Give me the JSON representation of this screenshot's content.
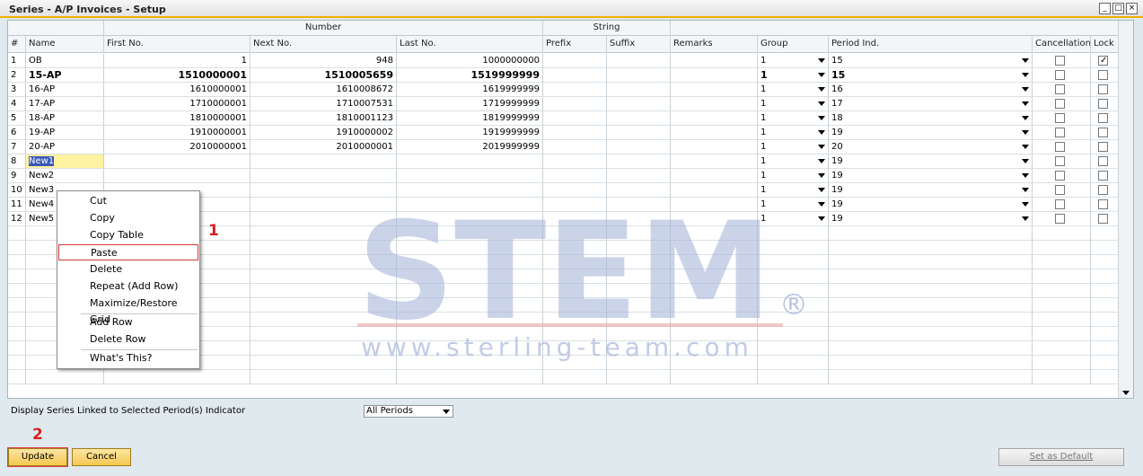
{
  "window": {
    "title": "Series - A/P Invoices - Setup",
    "controls": [
      "_",
      "□",
      "×"
    ]
  },
  "grid": {
    "group_headers": [
      "Number",
      "String"
    ],
    "columns": [
      "#",
      "Name",
      "First No.",
      "Next No.",
      "Last No.",
      "Prefix",
      "Suffix",
      "Remarks",
      "Group",
      "Period Ind.",
      "Cancellation",
      "Lock"
    ],
    "rows": [
      {
        "num": "1",
        "name": "OB",
        "first": "1",
        "next": "948",
        "last": "1000000000",
        "group": "1",
        "period": "15",
        "cancel": false,
        "lock": true,
        "bold": false
      },
      {
        "num": "2",
        "name": "15-AP",
        "first": "1510000001",
        "next": "1510005659",
        "last": "1519999999",
        "group": "1",
        "period": "15",
        "cancel": false,
        "lock": false,
        "bold": true
      },
      {
        "num": "3",
        "name": "16-AP",
        "first": "1610000001",
        "next": "1610008672",
        "last": "1619999999",
        "group": "1",
        "period": "16",
        "cancel": false,
        "lock": false,
        "bold": false
      },
      {
        "num": "4",
        "name": "17-AP",
        "first": "1710000001",
        "next": "1710007531",
        "last": "1719999999",
        "group": "1",
        "period": "17",
        "cancel": false,
        "lock": false,
        "bold": false
      },
      {
        "num": "5",
        "name": "18-AP",
        "first": "1810000001",
        "next": "1810001123",
        "last": "1819999999",
        "group": "1",
        "period": "18",
        "cancel": false,
        "lock": false,
        "bold": false
      },
      {
        "num": "6",
        "name": "19-AP",
        "first": "1910000001",
        "next": "1910000002",
        "last": "1919999999",
        "group": "1",
        "period": "19",
        "cancel": false,
        "lock": false,
        "bold": false
      },
      {
        "num": "7",
        "name": "20-AP",
        "first": "2010000001",
        "next": "2010000001",
        "last": "2019999999",
        "group": "1",
        "period": "20",
        "cancel": false,
        "lock": false,
        "bold": false
      },
      {
        "num": "8",
        "name": "New1",
        "first": "",
        "next": "",
        "last": "",
        "group": "1",
        "period": "19",
        "cancel": false,
        "lock": false,
        "bold": false
      },
      {
        "num": "9",
        "name": "New2",
        "first": "",
        "next": "",
        "last": "",
        "group": "1",
        "period": "19",
        "cancel": false,
        "lock": false,
        "bold": false
      },
      {
        "num": "10",
        "name": "New3",
        "first": "",
        "next": "",
        "last": "",
        "group": "1",
        "period": "19",
        "cancel": false,
        "lock": false,
        "bold": false
      },
      {
        "num": "11",
        "name": "New4",
        "first": "",
        "next": "",
        "last": "",
        "group": "1",
        "period": "19",
        "cancel": false,
        "lock": false,
        "bold": false
      },
      {
        "num": "12",
        "name": "New5",
        "first": "",
        "next": "",
        "last": "",
        "group": "1",
        "period": "19",
        "cancel": false,
        "lock": false,
        "bold": false
      }
    ]
  },
  "context_menu": {
    "items": [
      "Cut",
      "Copy",
      "Copy Table",
      "Paste",
      "Delete",
      "Repeat (Add Row)",
      "Maximize/Restore Grid",
      "Add Row",
      "Delete Row",
      "What's This?"
    ],
    "highlighted": "Paste"
  },
  "watermark": {
    "logo_text": "STEM",
    "registered": "®",
    "url": "www.sterling-team.com"
  },
  "annotations": {
    "marker_1": "1",
    "marker_2": "2"
  },
  "footer": {
    "linked_label": "Display Series Linked to Selected Period(s) Indicator",
    "period_select": "All Periods",
    "update_label": "Update",
    "cancel_label": "Cancel",
    "default_label": "Set as Default"
  },
  "colors": {
    "accent": "#f0b000",
    "button": "#f4c750",
    "highlight": "#d32020",
    "selection": "#3a58b8"
  }
}
